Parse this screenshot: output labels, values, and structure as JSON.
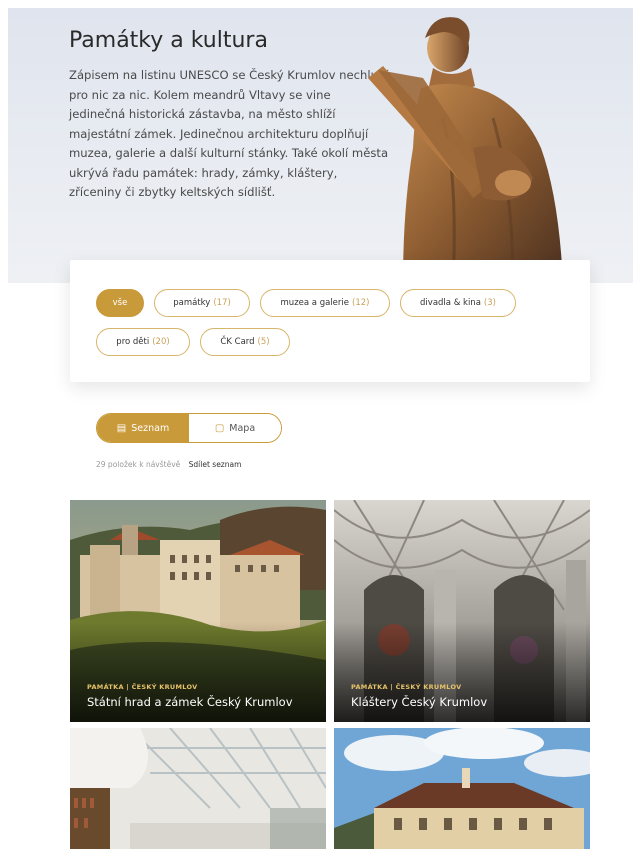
{
  "hero": {
    "title": "Památky a kultura",
    "text": "Zápisem na listinu UNESCO se Český Krumlov nechlubí pro nic za nic. Kolem meandrů Vltavy se vine jedinečná historická zástavba, na město shlíží majestátní zámek. Jedinečnou architekturu doplňují muzea, galerie a další kulturní stánky. Také okolí města ukrývá řadu památek: hrady, zámky, kláštery, zříceniny či zbytky keltských sídlišť."
  },
  "filters": [
    {
      "label": "vše",
      "count": ""
    },
    {
      "label": "památky",
      "count": "(17)"
    },
    {
      "label": "muzea a galerie",
      "count": "(12)"
    },
    {
      "label": "divadla & kina",
      "count": "(3)"
    },
    {
      "label": "pro děti",
      "count": "(20)"
    },
    {
      "label": "ČK Card",
      "count": "(5)"
    }
  ],
  "view_toggle": {
    "list_label": "Seznam",
    "list_icon": "list-icon",
    "map_label": "Mapa",
    "map_icon": "map-icon"
  },
  "results": {
    "count_text": "29 položek k návštěvě",
    "share_label": "Sdílet seznam"
  },
  "cards": [
    {
      "category": "PAMÁTKA | ČESKÝ KRUMLOV",
      "title": "Státní hrad a zámek Český Krumlov"
    },
    {
      "category": "PAMÁTKA | ČESKÝ KRUMLOV",
      "title": "Kláštery Český Krumlov"
    },
    {
      "category": "",
      "title": ""
    },
    {
      "category": "",
      "title": ""
    }
  ],
  "colors": {
    "accent": "#c99a3a",
    "accent_border": "#d7b56a",
    "category_text": "#e6c36a"
  }
}
